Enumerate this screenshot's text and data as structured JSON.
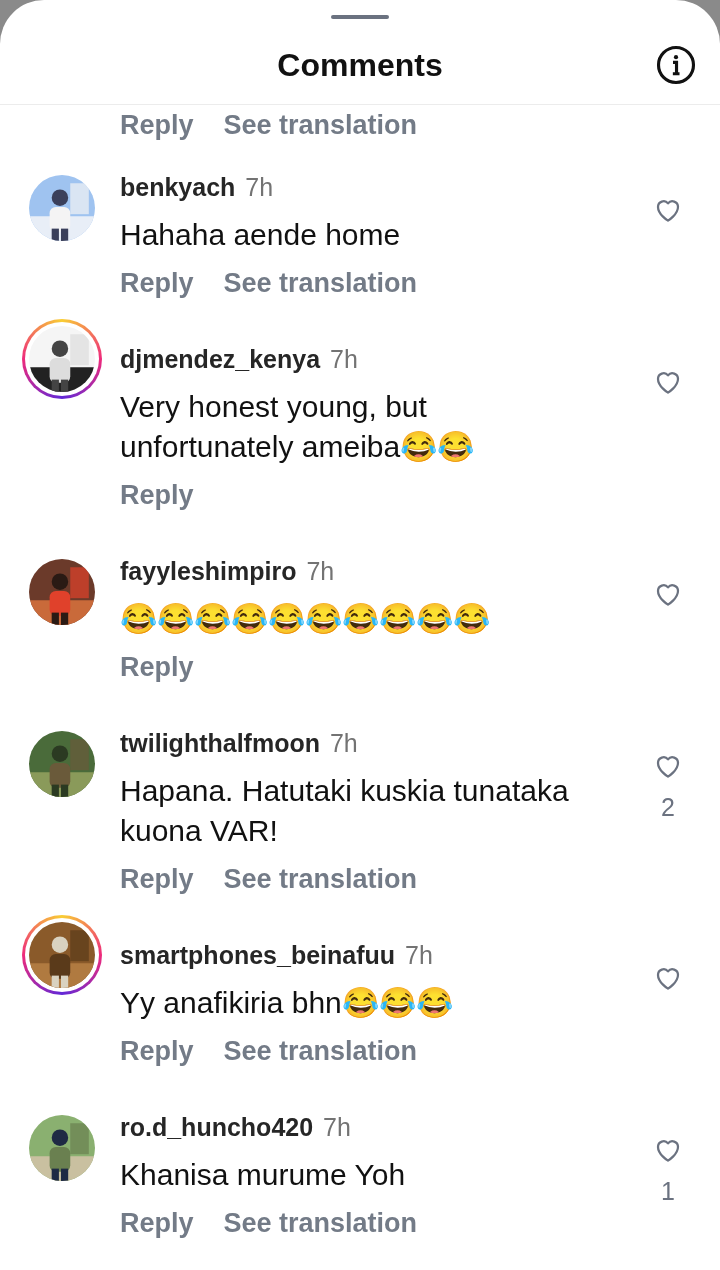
{
  "sheet": {
    "title": "Comments"
  },
  "cut_row": {
    "reply": "Reply",
    "translation": "See translation"
  },
  "comments": [
    {
      "username": "benkyach",
      "time": "7h",
      "text": "Hahaha aende home",
      "reply": "Reply",
      "translation": "See translation",
      "story_ring": false
    },
    {
      "username": "djmendez_kenya",
      "time": "7h",
      "text": "Very honest young, but unfortunately ameiba😂😂",
      "reply": "Reply",
      "story_ring": true
    },
    {
      "username": "fayyleshimpiro",
      "time": "7h",
      "text": "😂😂😂😂😂😂😂😂😂😂",
      "reply": "Reply",
      "story_ring": false
    },
    {
      "username": "twilighthalfmoon",
      "time": "7h",
      "text": "Hapana. Hatutaki kuskia tunataka kuona VAR!",
      "reply": "Reply",
      "translation": "See translation",
      "story_ring": false,
      "likes": "2"
    },
    {
      "username": "smartphones_beinafuu",
      "time": "7h",
      "text": "Yy anafikiria bhn😂😂😂",
      "reply": "Reply",
      "translation": "See translation",
      "story_ring": true
    },
    {
      "username": "ro.d_huncho420",
      "time": "7h",
      "text": "Khanisa murume Yoh",
      "reply": "Reply",
      "translation": "See translation",
      "story_ring": false,
      "likes": "1"
    }
  ]
}
